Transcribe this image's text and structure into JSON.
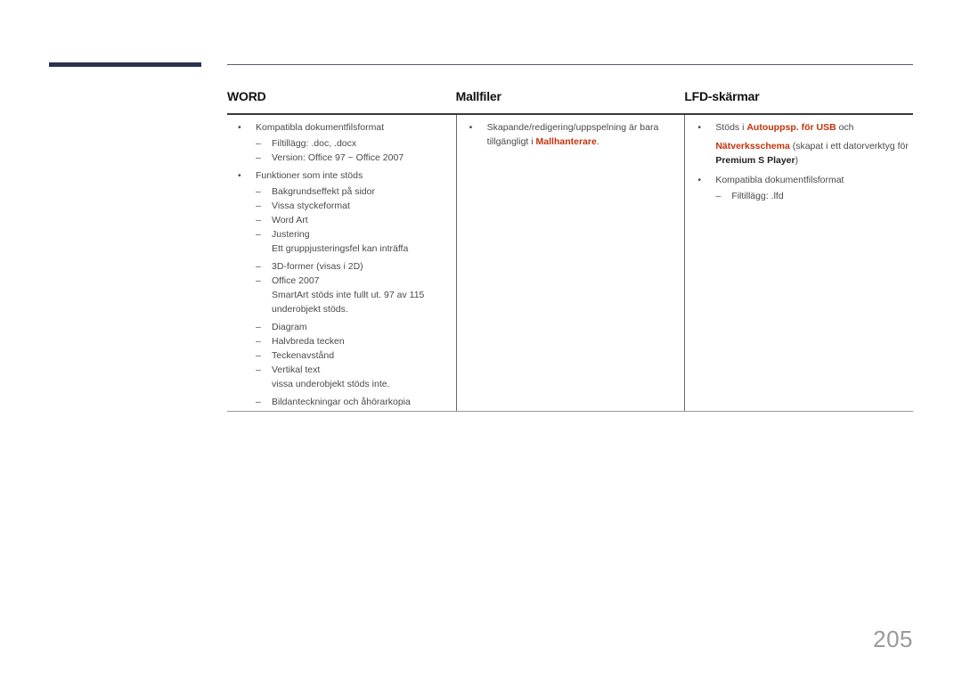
{
  "header": {
    "columns": [
      "WORD",
      "Mallfiler",
      "LFD-skärmar"
    ]
  },
  "word": {
    "bullet1": "Kompatibla dokumentfilsformat",
    "bullet1_subs": [
      "Filtillägg: .doc, .docx",
      "Version: Office 97 ~ Office 2007"
    ],
    "bullet2": "Funktioner som inte stöds",
    "bullet2_subs": [
      "Bakgrundseffekt på sidor",
      "Vissa styckeformat",
      "Word Art",
      "Justering",
      "3D-former (visas i 2D)",
      "Office 2007",
      "Diagram",
      "Halvbreda tecken",
      "Teckenavstånd",
      "Vertikal text",
      "Bildanteckningar och åhörarkopia"
    ],
    "notes": {
      "justering": "Ett gruppjusteringsfel kan inträffa",
      "office2007_line1": "SmartArt stöds inte fullt ut. 97 av 115",
      "office2007_line2": "underobjekt stöds.",
      "vertikal": "vissa underobjekt stöds inte."
    }
  },
  "mallfiler": {
    "line1": "Skapande/redigering/uppspelning är bara",
    "line2_prefix": "tillgängligt i ",
    "line2_link": "Mallhanterare",
    "line2_suffix": "."
  },
  "lfd": {
    "b1_prefix": "Stöds i ",
    "b1_link": "Autouppsp. för USB",
    "b1_suffix": " och",
    "b1_link2": "Nätverksschema",
    "b1_text2": " (skapat i ett datorverktyg för",
    "b1_bold": "Premium S Player",
    "b1_close": ")",
    "b2": "Kompatibla dokumentfilsformat",
    "b2_sub": "Filtillägg: .lfd"
  },
  "page_number": "205",
  "symbols": {
    "bullet": "•",
    "dash": "–"
  },
  "colors": {
    "accent": "#c1330b",
    "side_bar": "#2b3350"
  }
}
